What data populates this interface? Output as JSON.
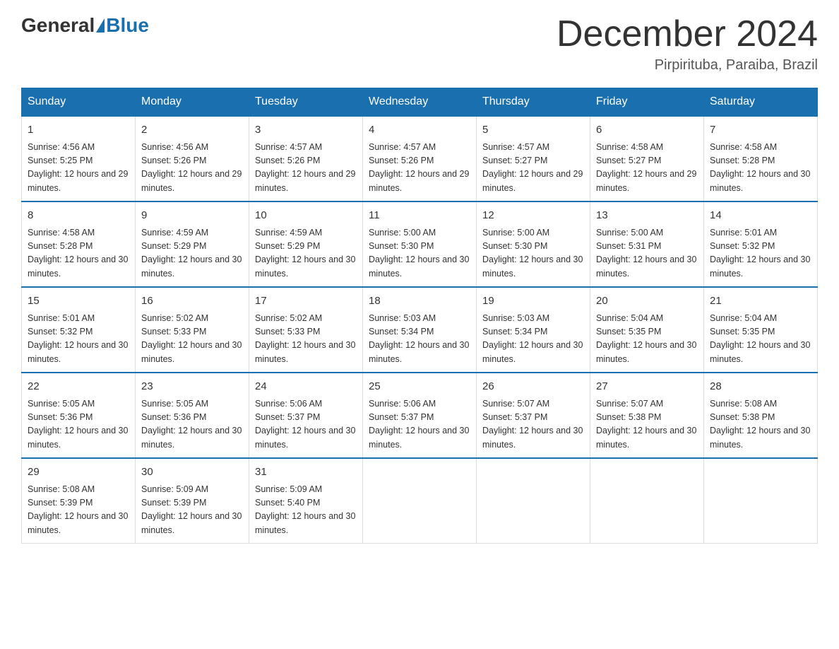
{
  "header": {
    "logo_general": "General",
    "logo_blue": "Blue",
    "month_year": "December 2024",
    "location": "Pirpirituba, Paraiba, Brazil"
  },
  "weekdays": [
    "Sunday",
    "Monday",
    "Tuesday",
    "Wednesday",
    "Thursday",
    "Friday",
    "Saturday"
  ],
  "weeks": [
    [
      {
        "day": "1",
        "sunrise": "4:56 AM",
        "sunset": "5:25 PM",
        "daylight": "12 hours and 29 minutes."
      },
      {
        "day": "2",
        "sunrise": "4:56 AM",
        "sunset": "5:26 PM",
        "daylight": "12 hours and 29 minutes."
      },
      {
        "day": "3",
        "sunrise": "4:57 AM",
        "sunset": "5:26 PM",
        "daylight": "12 hours and 29 minutes."
      },
      {
        "day": "4",
        "sunrise": "4:57 AM",
        "sunset": "5:26 PM",
        "daylight": "12 hours and 29 minutes."
      },
      {
        "day": "5",
        "sunrise": "4:57 AM",
        "sunset": "5:27 PM",
        "daylight": "12 hours and 29 minutes."
      },
      {
        "day": "6",
        "sunrise": "4:58 AM",
        "sunset": "5:27 PM",
        "daylight": "12 hours and 29 minutes."
      },
      {
        "day": "7",
        "sunrise": "4:58 AM",
        "sunset": "5:28 PM",
        "daylight": "12 hours and 30 minutes."
      }
    ],
    [
      {
        "day": "8",
        "sunrise": "4:58 AM",
        "sunset": "5:28 PM",
        "daylight": "12 hours and 30 minutes."
      },
      {
        "day": "9",
        "sunrise": "4:59 AM",
        "sunset": "5:29 PM",
        "daylight": "12 hours and 30 minutes."
      },
      {
        "day": "10",
        "sunrise": "4:59 AM",
        "sunset": "5:29 PM",
        "daylight": "12 hours and 30 minutes."
      },
      {
        "day": "11",
        "sunrise": "5:00 AM",
        "sunset": "5:30 PM",
        "daylight": "12 hours and 30 minutes."
      },
      {
        "day": "12",
        "sunrise": "5:00 AM",
        "sunset": "5:30 PM",
        "daylight": "12 hours and 30 minutes."
      },
      {
        "day": "13",
        "sunrise": "5:00 AM",
        "sunset": "5:31 PM",
        "daylight": "12 hours and 30 minutes."
      },
      {
        "day": "14",
        "sunrise": "5:01 AM",
        "sunset": "5:32 PM",
        "daylight": "12 hours and 30 minutes."
      }
    ],
    [
      {
        "day": "15",
        "sunrise": "5:01 AM",
        "sunset": "5:32 PM",
        "daylight": "12 hours and 30 minutes."
      },
      {
        "day": "16",
        "sunrise": "5:02 AM",
        "sunset": "5:33 PM",
        "daylight": "12 hours and 30 minutes."
      },
      {
        "day": "17",
        "sunrise": "5:02 AM",
        "sunset": "5:33 PM",
        "daylight": "12 hours and 30 minutes."
      },
      {
        "day": "18",
        "sunrise": "5:03 AM",
        "sunset": "5:34 PM",
        "daylight": "12 hours and 30 minutes."
      },
      {
        "day": "19",
        "sunrise": "5:03 AM",
        "sunset": "5:34 PM",
        "daylight": "12 hours and 30 minutes."
      },
      {
        "day": "20",
        "sunrise": "5:04 AM",
        "sunset": "5:35 PM",
        "daylight": "12 hours and 30 minutes."
      },
      {
        "day": "21",
        "sunrise": "5:04 AM",
        "sunset": "5:35 PM",
        "daylight": "12 hours and 30 minutes."
      }
    ],
    [
      {
        "day": "22",
        "sunrise": "5:05 AM",
        "sunset": "5:36 PM",
        "daylight": "12 hours and 30 minutes."
      },
      {
        "day": "23",
        "sunrise": "5:05 AM",
        "sunset": "5:36 PM",
        "daylight": "12 hours and 30 minutes."
      },
      {
        "day": "24",
        "sunrise": "5:06 AM",
        "sunset": "5:37 PM",
        "daylight": "12 hours and 30 minutes."
      },
      {
        "day": "25",
        "sunrise": "5:06 AM",
        "sunset": "5:37 PM",
        "daylight": "12 hours and 30 minutes."
      },
      {
        "day": "26",
        "sunrise": "5:07 AM",
        "sunset": "5:37 PM",
        "daylight": "12 hours and 30 minutes."
      },
      {
        "day": "27",
        "sunrise": "5:07 AM",
        "sunset": "5:38 PM",
        "daylight": "12 hours and 30 minutes."
      },
      {
        "day": "28",
        "sunrise": "5:08 AM",
        "sunset": "5:38 PM",
        "daylight": "12 hours and 30 minutes."
      }
    ],
    [
      {
        "day": "29",
        "sunrise": "5:08 AM",
        "sunset": "5:39 PM",
        "daylight": "12 hours and 30 minutes."
      },
      {
        "day": "30",
        "sunrise": "5:09 AM",
        "sunset": "5:39 PM",
        "daylight": "12 hours and 30 minutes."
      },
      {
        "day": "31",
        "sunrise": "5:09 AM",
        "sunset": "5:40 PM",
        "daylight": "12 hours and 30 minutes."
      },
      null,
      null,
      null,
      null
    ]
  ]
}
